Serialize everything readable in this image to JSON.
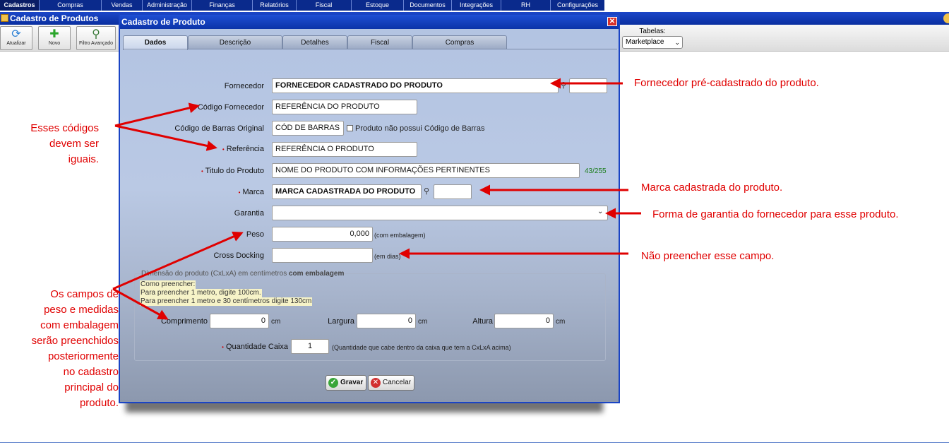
{
  "menu": {
    "items": [
      "Cadastros",
      "Compras",
      "Vendas",
      "Administração",
      "Finanças",
      "Relatórios",
      "Fiscal",
      "Estoque",
      "Documentos",
      "Integrações",
      "RH",
      "Configurações"
    ]
  },
  "window": {
    "title": "Cadastro de Produtos"
  },
  "toolbar": {
    "refresh_label": "Atualizar",
    "new_label": "Novo",
    "filter_label": "Filtro Avançado",
    "tables_label": "Tabelas:",
    "tables_value": "Marketplace"
  },
  "modal": {
    "title": "Cadastro de Produto",
    "close_glyph": "✕",
    "tabs": [
      "Dados",
      "Descrição",
      "Detalhes",
      "Fiscal",
      "Compras"
    ]
  },
  "form": {
    "fornecedor_label": "Fornecedor",
    "fornecedor_value": "FORNECEDOR CADASTRADO DO PRODUTO",
    "codigo_fornecedor_label": "Código Fornecedor",
    "codigo_fornecedor_value": "REFERÊNCIA DO PRODUTO",
    "codigo_barras_label": "Código de Barras Original",
    "codigo_barras_value": "CÓD DE BARRAS",
    "sem_codigo_label": "Produto não possui Código de Barras",
    "referencia_label": "Referência",
    "referencia_value": "REFERÊNCIA O PRODUTO",
    "titulo_label": "Titulo do Produto",
    "titulo_value": "NOME DO PRODUTO COM INFORMAÇÕES PERTINENTES",
    "titulo_counter": "43/255",
    "marca_label": "Marca",
    "marca_value": "MARCA CADASTRADA DO PRODUTO",
    "garantia_label": "Garantia",
    "garantia_value": "",
    "peso_label": "Peso",
    "peso_value": "0,000",
    "peso_note": "(com embalagem)",
    "cross_label": "Cross Docking",
    "cross_value": "",
    "cross_note": "(em dias)",
    "required_mark": "•"
  },
  "dimensions": {
    "legend_prefix": "Dimensão do produto (CxLxA) em centímetros ",
    "legend_bold": "com embalagem",
    "hint_1": "Como preencher:",
    "hint_2": "Para preencher 1 metro, digite 100cm.",
    "hint_3": "Para preencher 1 metro e 30 centímetros digite 130cm",
    "comprimento_label": "Comprimento",
    "comprimento_value": "0",
    "largura_label": "Largura",
    "largura_value": "0",
    "altura_label": "Altura",
    "altura_value": "0",
    "unit": "cm",
    "qtd_label": "Quantidade Caixa",
    "qtd_value": "1",
    "qtd_note": "(Quantidade que cabe dentro da caixa que tem a CxLxA acima)"
  },
  "buttons": {
    "save_label": "Gravar",
    "cancel_label": "Cancelar"
  },
  "annotations": {
    "fornecedor": "Fornecedor pré-cadastrado do produto.",
    "codigos_1": "Esses códigos",
    "codigos_2": "devem ser",
    "codigos_3": "iguais.",
    "marca": "Marca cadastrada do produto.",
    "garantia": "Forma de garantia do fornecedor para esse produto.",
    "cross": "Não preencher esse campo.",
    "peso_1": "Os campos de",
    "peso_2": "peso e medidas",
    "peso_3": "com embalagem",
    "peso_4": "serão preenchidos",
    "peso_5": "posteriormente",
    "peso_6": "no cadastro",
    "peso_7": "principal do",
    "peso_8": "produto."
  },
  "colors": {
    "annotation": "#e00000",
    "menu_bg": "#0a2a8c",
    "modal_border": "#1a44c4"
  }
}
